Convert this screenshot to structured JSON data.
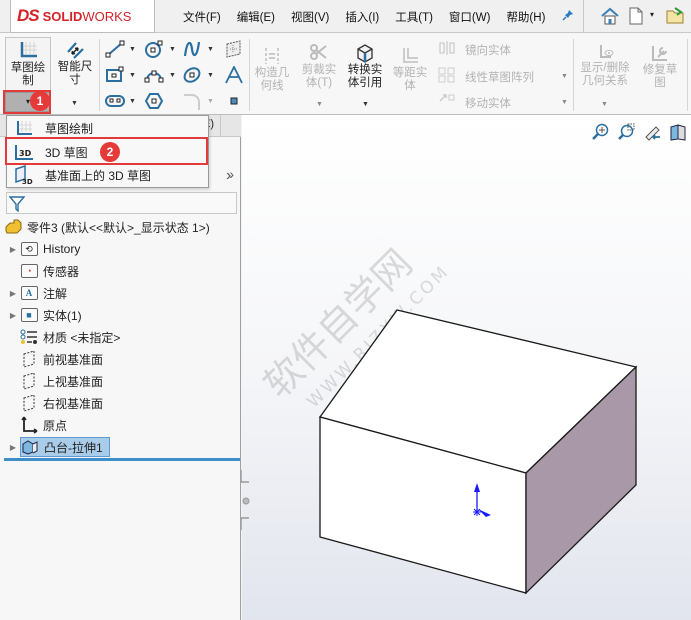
{
  "app": {
    "logo_ds": "DS",
    "logo_solid": "SOLID",
    "logo_works": "WORKS"
  },
  "menu": {
    "items": [
      "文件(F)",
      "编辑(E)",
      "视图(V)",
      "插入(I)",
      "工具(T)",
      "窗口(W)",
      "帮助(H)"
    ]
  },
  "titlebar_icons": [
    "pin-icon",
    "home-icon",
    "new-document-icon",
    "open-folder-icon"
  ],
  "ribbon": {
    "sketch_button": {
      "label_line1": "草图绘",
      "label_line2": "制",
      "badge": "1"
    },
    "smart_dimension": {
      "label_line1": "智能尺",
      "label_line2": "寸"
    },
    "small_tools": [
      "line-tool",
      "circle-tool",
      "spline-tool",
      "plane-tool",
      "rectangle-tool",
      "arc-tool",
      "ellipse-tool",
      "text-tool",
      "slot-tool",
      "polygon-tool",
      "fillet-tool",
      "point-tool"
    ],
    "construction_geometry": {
      "label_line1": "构造几",
      "label_line2": "何线",
      "disabled": true
    },
    "trim_entities": {
      "label_line1": "剪裁实",
      "label_line2": "体(T)",
      "disabled": true
    },
    "convert_entities": {
      "label_line1": "转换实",
      "label_line2": "体引用",
      "disabled": false
    },
    "offset_entities": {
      "label_line1": "等距实",
      "label_line2": "体",
      "disabled": true
    },
    "mirror_entities": {
      "label": "镜向实体",
      "disabled": true
    },
    "linear_pattern": {
      "label": "线性草图阵列",
      "disabled": true
    },
    "move_entities": {
      "label": "移动实体",
      "disabled": true
    },
    "display_relations": {
      "label_line1": "显示/删除",
      "label_line2": "几何关系",
      "disabled": true
    },
    "repair_sketch": {
      "label_line1": "修复草",
      "label_line2": "图",
      "disabled": true
    }
  },
  "dropdown": {
    "items": [
      {
        "label": "草图绘制",
        "icon": "sketch-icon"
      },
      {
        "label": "3D 草图",
        "icon": "3d-sketch-icon",
        "highlighted": true,
        "badge": "2"
      },
      {
        "label": "基准面上的 3D 草图",
        "icon": "3d-sketch-on-plane-icon",
        "has_submenu": true
      }
    ]
  },
  "tabs": {
    "partial_label": "E)"
  },
  "tree": {
    "root": "零件3  (默认<<默认>_显示状态 1>)",
    "items": [
      {
        "label": "History",
        "icon": "history-folder-icon",
        "expandable": true
      },
      {
        "label": "传感器",
        "icon": "sensor-folder-icon",
        "expandable": false
      },
      {
        "label": "注解",
        "icon": "annotation-folder-icon",
        "expandable": true
      },
      {
        "label": "实体(1)",
        "icon": "solid-bodies-folder-icon",
        "expandable": true
      },
      {
        "label": "材质 <未指定>",
        "icon": "material-icon",
        "expandable": false
      },
      {
        "label": "前视基准面",
        "icon": "plane-icon",
        "expandable": false
      },
      {
        "label": "上视基准面",
        "icon": "plane-icon",
        "expandable": false
      },
      {
        "label": "右视基准面",
        "icon": "plane-icon",
        "expandable": false
      },
      {
        "label": "原点",
        "icon": "origin-icon",
        "expandable": false
      },
      {
        "label": "凸台-拉伸1",
        "icon": "extrude-icon",
        "expandable": true,
        "selected": true
      }
    ]
  },
  "viewport": {
    "tools": [
      "zoom-to-fit-icon",
      "zoom-to-area-icon",
      "previous-view-icon",
      "section-view-icon"
    ],
    "watermark_cn": "软件自学网",
    "watermark_url": "WWW.RJZXW.COM",
    "model_side_color": "#a898a8"
  },
  "colors": {
    "accent": "#3d8ec9",
    "highlight_red": "#e53a3a",
    "brand_red": "#d3222a",
    "selection": "#a9cce8"
  }
}
